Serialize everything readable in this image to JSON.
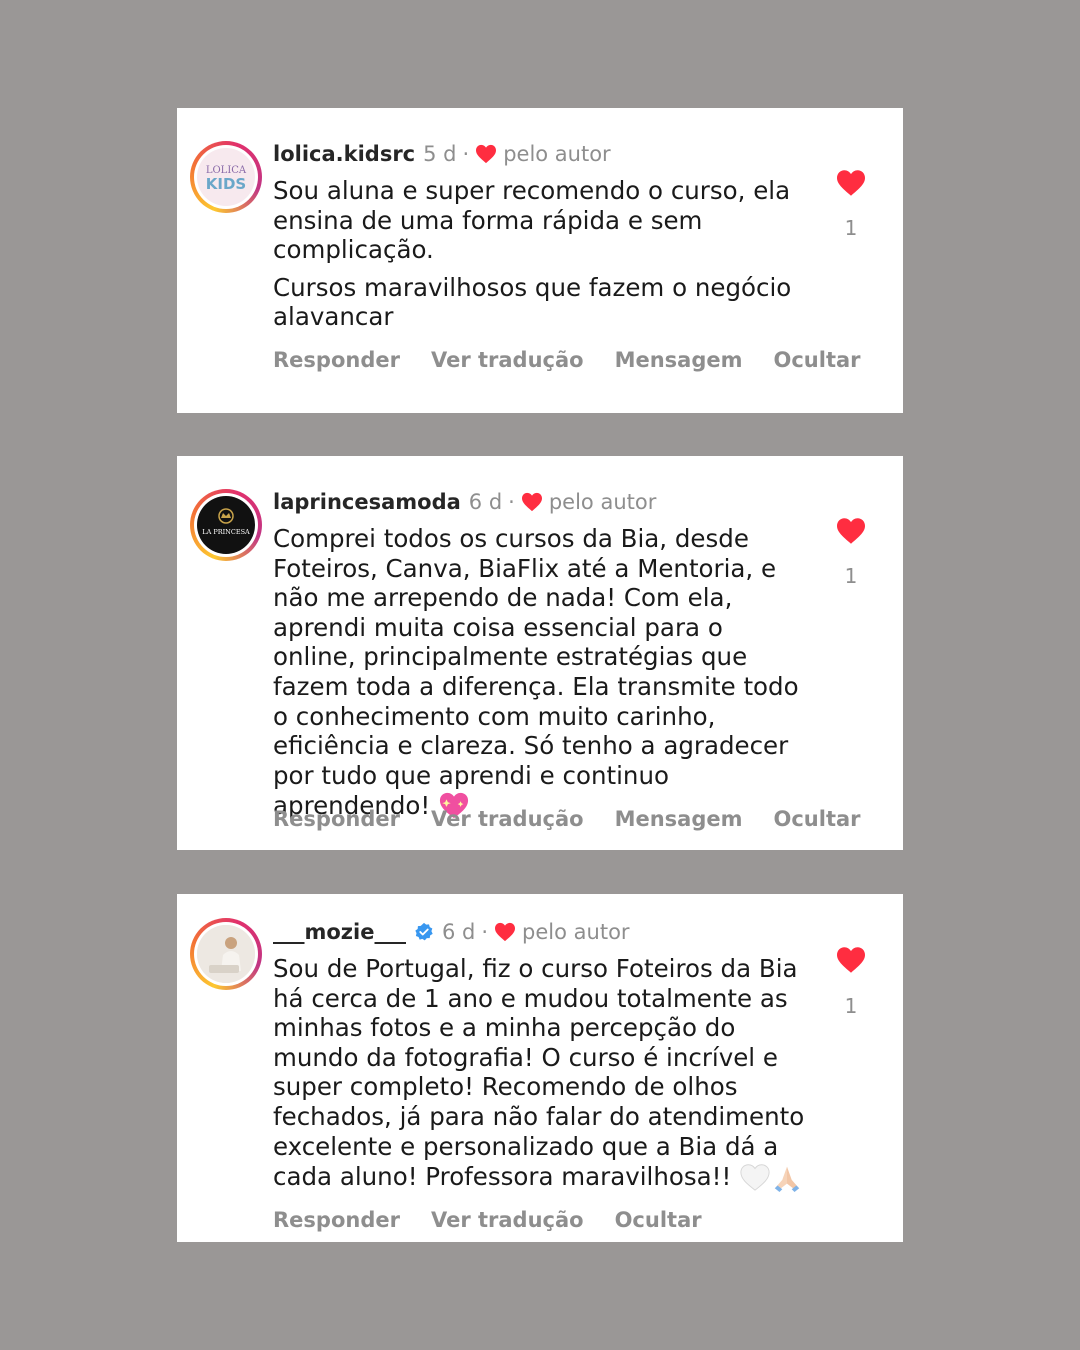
{
  "comments": [
    {
      "username": "lolica.kidsrc",
      "time": "5 d",
      "separator": "·",
      "liked_by_author": "pelo autor",
      "paragraphs": [
        "Sou aluna e super recomendo o curso, ela ensina de uma forma rápida e sem complicação.",
        "Cursos maravilhosos que fazem o negócio alavancar"
      ],
      "actions": [
        "Responder",
        "Ver tradução",
        "Mensagem",
        "Ocultar"
      ],
      "likes": "1",
      "avatar_text": [
        "LOLICA",
        "KIDS"
      ]
    },
    {
      "username": "laprincesamoda",
      "time": "6 d",
      "separator": "·",
      "liked_by_author": "pelo autor",
      "paragraphs": [
        "Comprei todos os cursos da Bia, desde Foteiros, Canva, BiaFlix até a Mentoria, e não me arrependo de nada! Com ela, aprendi muita coisa essencial para o online, principalmente estratégias que fazem toda a diferença. Ela transmite todo o conhecimento com muito carinho, eficiência e clareza. Só tenho a agradecer por tudo que aprendi e continuo aprendendo!"
      ],
      "actions": [
        "Responder",
        "Ver tradução",
        "Mensagem",
        "Ocultar"
      ],
      "likes": "1",
      "avatar_text": [
        "LA PRINCESA"
      ]
    },
    {
      "username": "___mozie___",
      "time": "6 d",
      "separator": "·",
      "liked_by_author": "pelo autor",
      "paragraphs": [
        "Sou de Portugal, fiz o curso Foteiros da Bia há cerca de 1 ano e mudou totalmente as minhas fotos e a minha percepção do mundo da fotografia! O curso é incrível e super completo! Recomendo de olhos fechados, já para não falar do atendimento excelente e personalizado que a Bia dá a cada aluno! Professora maravilhosa!!"
      ],
      "actions": [
        "Responder",
        "Ver tradução",
        "Ocultar"
      ],
      "likes": "1"
    }
  ],
  "colors": {
    "background": "#9a9796",
    "card": "#ffffff",
    "heart": "#ff2d40",
    "muted": "#8e8e8e",
    "text": "#1a1a1a",
    "verified": "#3897f0"
  },
  "icons": [
    "heart-icon",
    "verified-badge-icon",
    "sparkling-heart-emoji",
    "white-heart-emoji",
    "folded-hands-emoji"
  ]
}
